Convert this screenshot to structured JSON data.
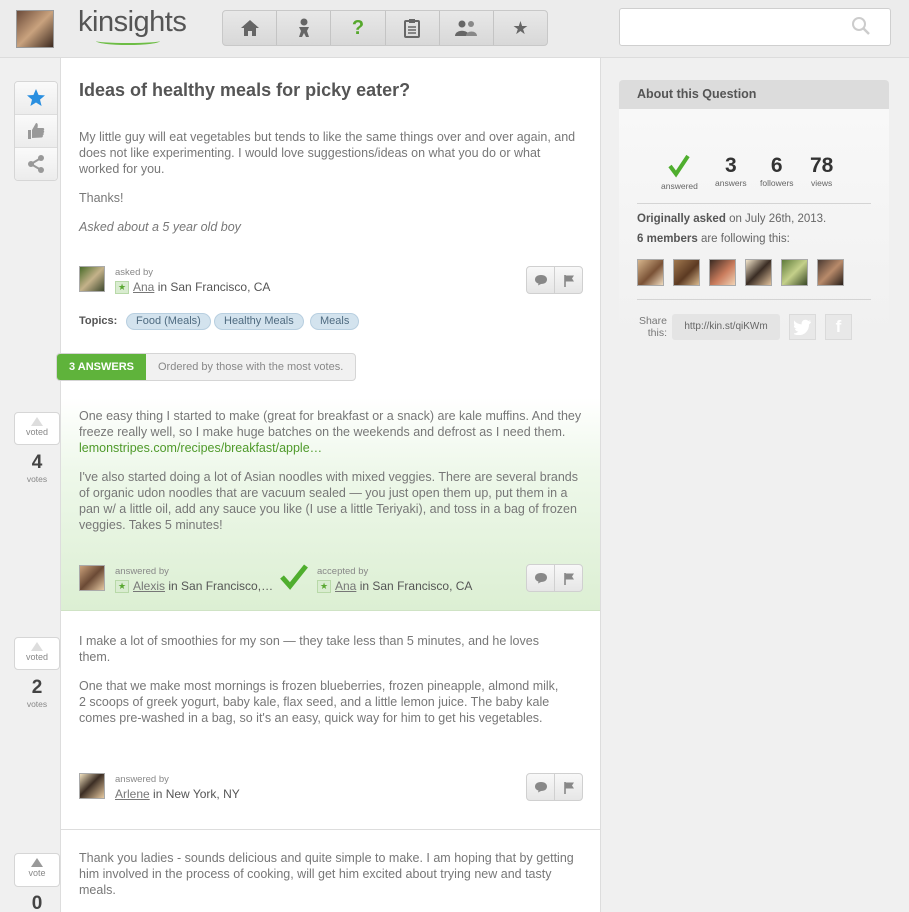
{
  "header": {
    "logo": "kinsights",
    "nav": [
      "home-icon",
      "child-icon",
      "question-icon",
      "clipboard-icon",
      "people-icon",
      "star-icon"
    ],
    "search_placeholder": ""
  },
  "question": {
    "title": "Ideas of healthy meals for picky eater?",
    "body": "My little guy will eat vegetables but tends to like the same things over and over again, and does not like experimenting. I would love suggestions/ideas on what you do or what worked for you.",
    "thanks": "Thanks!",
    "asked_about": "Asked about a 5 year old boy",
    "asked_by_label": "asked by",
    "asker": "Ana",
    "asker_location": "in San Francisco, CA",
    "topics_label": "Topics:",
    "topics": [
      "Food (Meals)",
      "Healthy Meals",
      "Meals"
    ]
  },
  "answers_bar": {
    "count_label": "3 ANSWERS",
    "sort_label": "Ordered by those with the most votes."
  },
  "answers": [
    {
      "vote_label": "voted",
      "votes": "4",
      "votes_word": "votes",
      "p1": "One easy thing I started to make (great for breakfast or a snack) are kale muffins. And they freeze really well, so I make huge batches on the weekends and defrost as I need them. ",
      "link": "lemonstripes.com/recipes/breakfast/apple…",
      "p2": "I've also started doing a lot of Asian noodles with mixed veggies. There are several brands of organic udon noodles that are vacuum sealed — you just open them up, put them in a pan w/ a little oil, add any sauce you like (I use a little Teriyaki), and toss in a bag of frozen veggies. Takes 5 minutes!",
      "answered_by_label": "answered by",
      "author": "Alexis",
      "author_location": "in San Francisco,…",
      "accepted_by_label": "accepted by",
      "acceptor": "Ana",
      "acceptor_location": "in San Francisco, CA"
    },
    {
      "vote_label": "voted",
      "votes": "2",
      "votes_word": "votes",
      "p1": "I make a lot of smoothies for my son — they take less than 5 minutes, and he loves them.",
      "p2": "One that we make most mornings is frozen blueberries, frozen pineapple, almond milk, 2 scoops of greek yogurt, baby kale, flax seed, and a little lemon juice. The baby kale comes pre-washed in a bag, so it's an easy, quick way for him to get his vegetables.",
      "answered_by_label": "answered by",
      "author": "Arlene",
      "author_location": "in New York, NY"
    },
    {
      "vote_label": "vote",
      "votes": "0",
      "p1": "Thank you ladies - sounds delicious and quite simple to make. I am hoping that by getting him involved in the process of cooking, will get him excited about trying new and tasty meals."
    }
  ],
  "about": {
    "title": "About this Question",
    "stats": [
      {
        "value": "",
        "label": "answered"
      },
      {
        "value": "3",
        "label": "answers"
      },
      {
        "value": "6",
        "label": "followers"
      },
      {
        "value": "78",
        "label": "views"
      }
    ],
    "asked_prefix": "Originally asked",
    "asked_date": "on July 26th, 2013.",
    "following_prefix": "6 members",
    "following_suffix": "are following this:",
    "share_label": "Share this:",
    "share_url": "http://kin.st/qiKWm"
  }
}
